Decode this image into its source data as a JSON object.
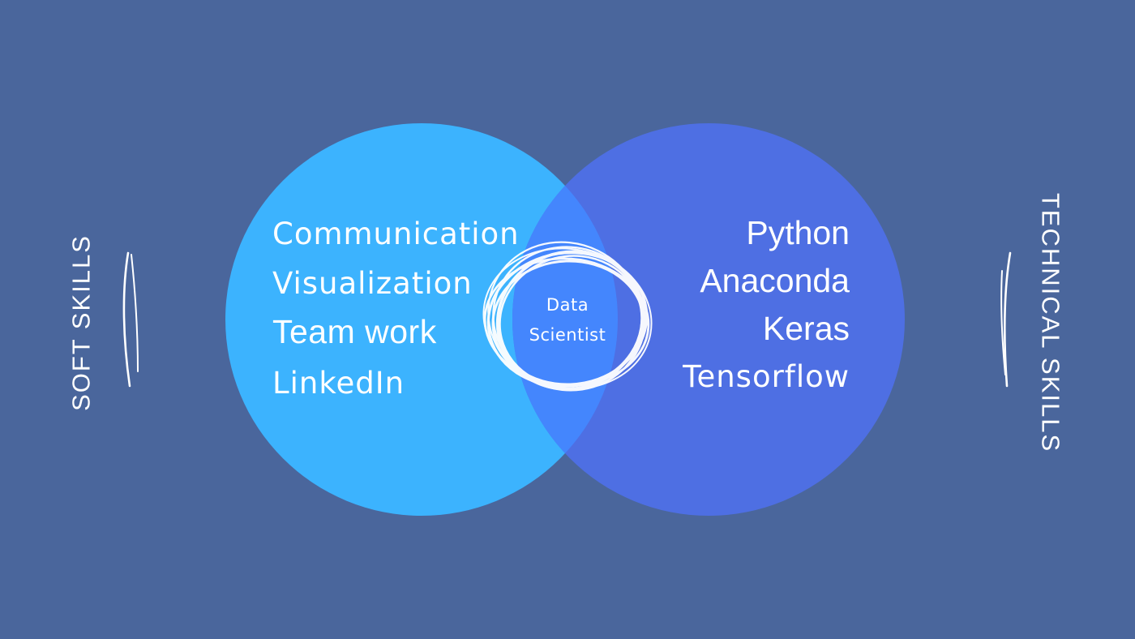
{
  "colors": {
    "background": "#4a669c",
    "left_circle": "#3cb3fe",
    "right_circle": "#4e6fe3",
    "overlap": "#4486fd",
    "text": "#ffffff"
  },
  "soft_skills": {
    "label": "SOFT SKILLS",
    "items": [
      "Communication",
      "Visualization",
      "Team work",
      "LinkedIn"
    ]
  },
  "technical_skills": {
    "label": "TECHNICAL SKILLS",
    "items": [
      "Python",
      "Anaconda",
      "Keras",
      "Tensorflow"
    ]
  },
  "center": {
    "line1": "Data",
    "line2": "Scientist"
  }
}
